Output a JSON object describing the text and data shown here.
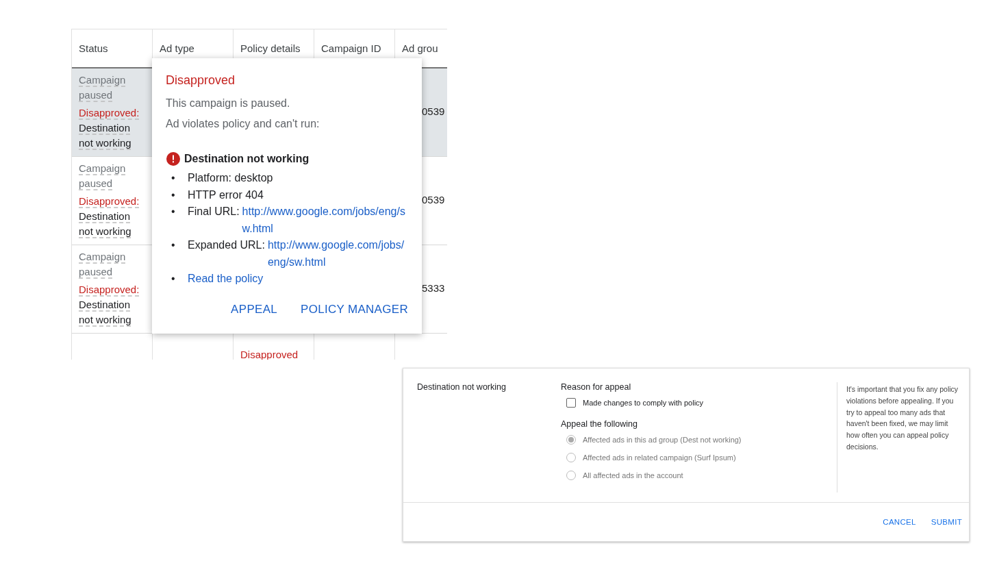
{
  "table": {
    "columns": [
      "Status",
      "Ad type",
      "Policy details",
      "Campaign ID",
      "Ad grou"
    ],
    "rows": [
      {
        "selected": true,
        "status": {
          "state": "Campaign paused",
          "label": "Disapproved:",
          "reason": "Destination not working"
        },
        "ad_group": "0539"
      },
      {
        "selected": false,
        "status": {
          "state": "Campaign paused",
          "label": "Disapproved:",
          "reason": "Destination not working"
        },
        "ad_group": "0539"
      },
      {
        "selected": false,
        "status": {
          "state": "Campaign paused",
          "label": "Disapproved:",
          "reason": "Destination not working"
        },
        "ad_group": "5333"
      },
      {
        "selected": false,
        "policy_details": "Disapproved"
      }
    ]
  },
  "popover": {
    "title": "Disapproved",
    "lines": [
      "This campaign is paused.",
      "Ad violates policy and can't run:"
    ],
    "issue": {
      "title": "Destination not working",
      "details": [
        {
          "marker": "•",
          "label": "Platform: desktop"
        },
        {
          "marker": "•",
          "label": "HTTP error 404"
        },
        {
          "marker": "•",
          "label": "Final URL:",
          "link": "http://www.google.com/jobs/eng/sw.html"
        },
        {
          "marker": "•",
          "label": "Expanded URL:",
          "link": "http://www.google.com/jobs/eng/sw.html"
        },
        {
          "marker": "•",
          "link": "Read the policy"
        }
      ]
    },
    "actions": [
      "APPEAL",
      "POLICY MANAGER"
    ]
  },
  "appeal_form": {
    "policy": "Destination not working",
    "reason_heading": "Reason for appeal",
    "reasons": [
      {
        "label": "Made changes to comply with policy",
        "checked": false
      }
    ],
    "scope_heading": "Appeal the following",
    "scopes": [
      {
        "label": "Affected ads in this ad group (Dest not working)",
        "selected": true,
        "disabled": true
      },
      {
        "label": "Affected ads in related campaign (Surf Ipsum)",
        "selected": false,
        "disabled": true
      },
      {
        "label": "All affected ads in the account",
        "selected": false,
        "disabled": true
      }
    ],
    "note": "It's important that you fix any policy violations before appealing. If you try to appeal too many ads that haven't been fixed, we may limit how often you can appeal policy decisions.",
    "actions": [
      "CANCEL",
      "SUBMIT"
    ]
  }
}
